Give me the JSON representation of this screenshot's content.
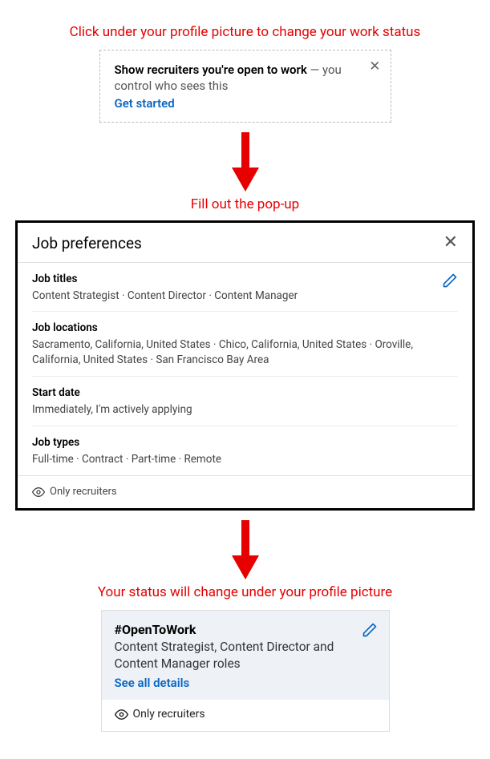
{
  "instructions": {
    "step1": "Click under your profile picture to change your work status",
    "step2": "Fill out the pop-up",
    "step3": "Your status will change under your profile picture"
  },
  "promo_card": {
    "bold": "Show recruiters you're open to work",
    "rest": " — you control who sees this",
    "cta": "Get started"
  },
  "popup": {
    "title": "Job preferences",
    "sections": {
      "job_titles": {
        "label": "Job titles",
        "value": "Content Strategist · Content Director · Content Manager"
      },
      "job_locations": {
        "label": "Job locations",
        "value": "Sacramento, California, United States · Chico, California, United States · Oroville, California, United States · San Francisco Bay Area"
      },
      "start_date": {
        "label": "Start date",
        "value": "Immediately, I'm actively applying"
      },
      "job_types": {
        "label": "Job types",
        "value": "Full-time · Contract · Part-time · Remote"
      }
    },
    "footer": "Only recruiters"
  },
  "status_card": {
    "hashtag": "#OpenToWork",
    "description": "Content Strategist, Content Director and Content Manager roles",
    "see_all": "See all details",
    "footer": "Only recruiters"
  }
}
